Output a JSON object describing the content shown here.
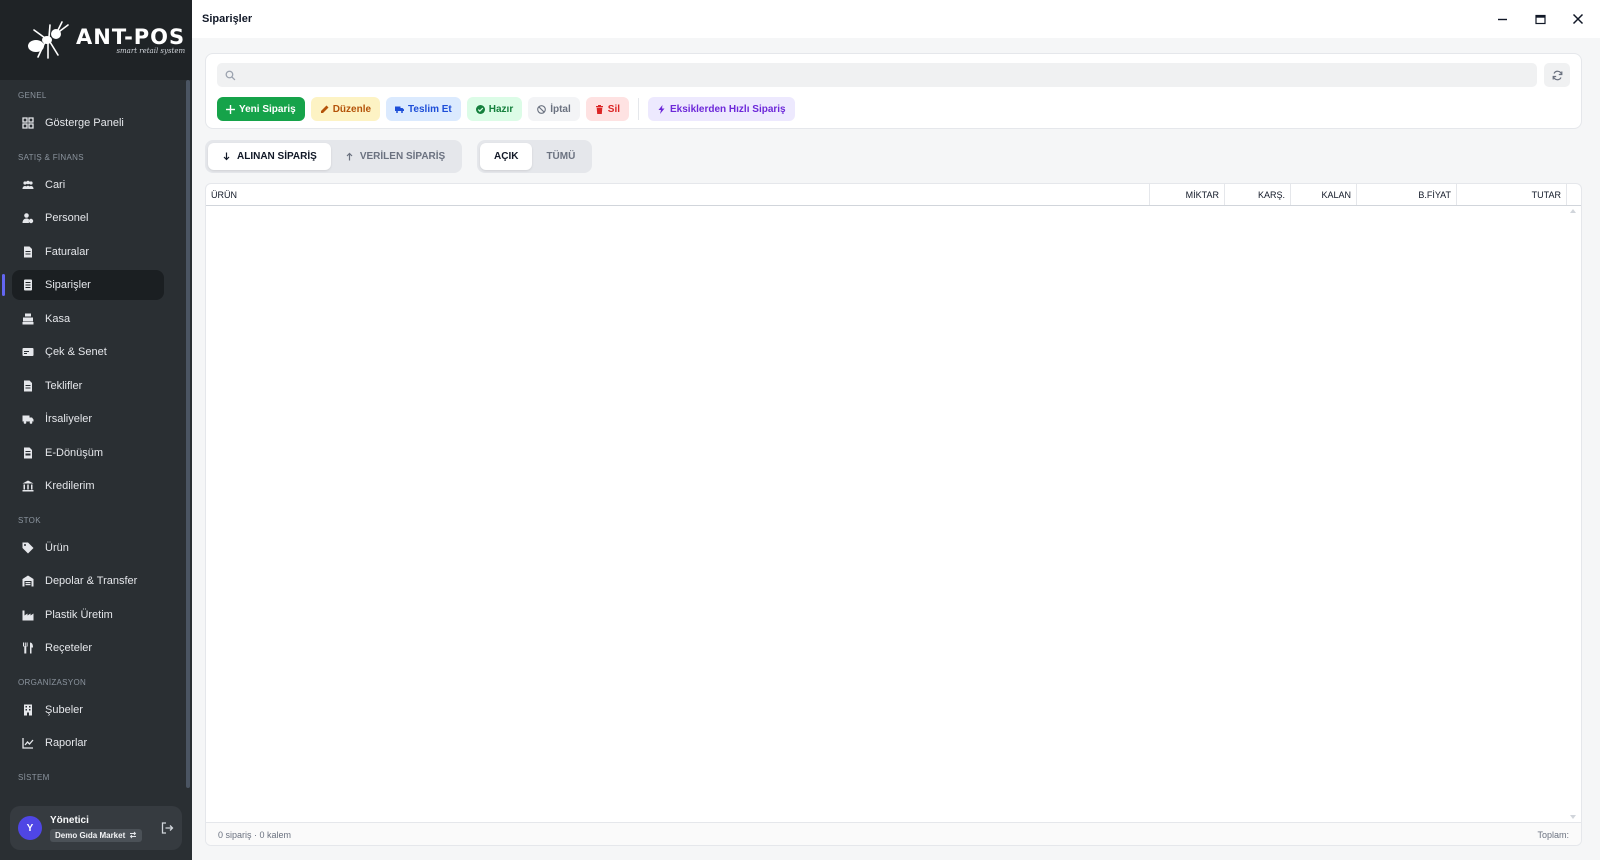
{
  "brand": {
    "name": "ANT-POS",
    "tagline": "smart retail system"
  },
  "sidebar": {
    "sections": {
      "general": "GENEL",
      "sales": "SATIŞ & FİNANS",
      "stock": "STOK",
      "org": "ORGANİZASYON",
      "system": "SİSTEM"
    },
    "items": {
      "dashboard": "Gösterge Paneli",
      "cari": "Cari",
      "personel": "Personel",
      "faturalar": "Faturalar",
      "siparisler": "Siparişler",
      "kasa": "Kasa",
      "cek": "Çek & Senet",
      "teklifler": "Teklifler",
      "irsaliyeler": "İrsaliyeler",
      "edonusum": "E-Dönüşüm",
      "kredilerim": "Kredilerim",
      "urun": "Ürün",
      "depolar": "Depolar & Transfer",
      "plastik": "Plastik Üretim",
      "receteler": "Reçeteler",
      "subeler": "Şubeler",
      "raporlar": "Raporlar"
    },
    "user": {
      "initial": "Y",
      "name": "Yönetici",
      "branch": "Demo Gıda Market"
    }
  },
  "window": {
    "title": "Siparişler"
  },
  "search": {
    "placeholder": "",
    "value": ""
  },
  "actions": {
    "new": "Yeni Sipariş",
    "edit": "Düzenle",
    "deliver": "Teslim Et",
    "ready": "Hazır",
    "cancel": "İptal",
    "delete": "Sil",
    "quick": "Eksiklerden Hızlı Sipariş"
  },
  "direction_tabs": {
    "received": "ALINAN SİPARİŞ",
    "given": "VERİLEN SİPARİŞ",
    "active": "received"
  },
  "status_tabs": {
    "open": "AÇIK",
    "all": "TÜMÜ",
    "active": "open"
  },
  "table": {
    "columns": [
      "ÜRÜN",
      "MİKTAR",
      "KARŞ.",
      "KALAN",
      "B.FİYAT",
      "TUTAR"
    ],
    "rows": []
  },
  "footer": {
    "summary": "0 sipariş · 0 kalem",
    "total_label": "Toplam:"
  },
  "colors": {
    "accent": "#6366f1",
    "primary": "#16a34a",
    "sidebar_bg": "#2a2f33"
  }
}
